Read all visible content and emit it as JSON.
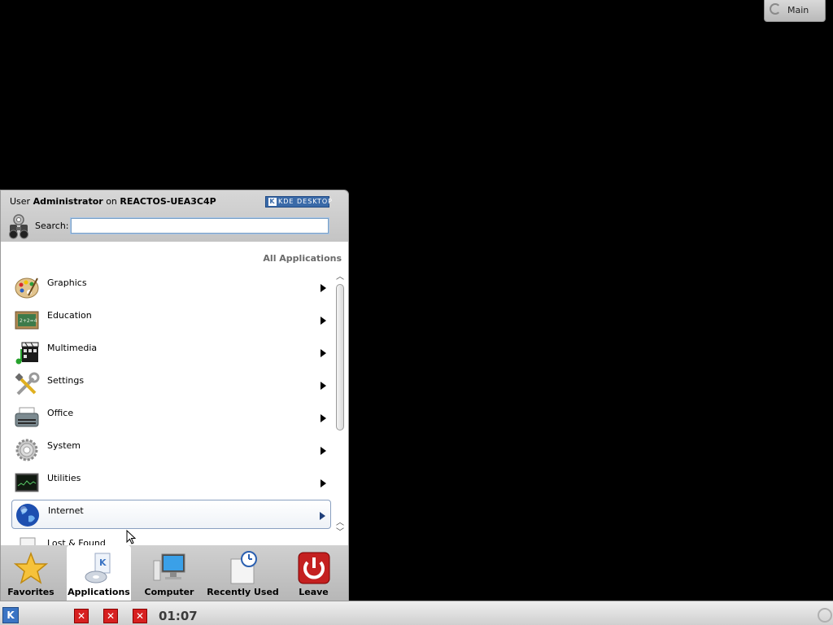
{
  "pager": {
    "label": "Main"
  },
  "launcher": {
    "header": {
      "user_prefix": "User",
      "user_name": "Administrator",
      "on_text": "on",
      "host": "REACTOS-UEA3C4P",
      "badge": "DESKTOP"
    },
    "search": {
      "label": "Search:",
      "value": "",
      "placeholder": ""
    },
    "section_title": "All Applications",
    "categories": [
      {
        "label": "Graphics",
        "icon": "palette-icon"
      },
      {
        "label": "Education",
        "icon": "chalkboard-icon"
      },
      {
        "label": "Multimedia",
        "icon": "film-music-icon"
      },
      {
        "label": "Settings",
        "icon": "tools-icon"
      },
      {
        "label": "Office",
        "icon": "typewriter-icon"
      },
      {
        "label": "System",
        "icon": "gear-icon"
      },
      {
        "label": "Utilities",
        "icon": "monitor-icon"
      },
      {
        "label": "Internet",
        "icon": "globe-icon"
      },
      {
        "label": "Lost & Found",
        "icon": "folder-icon"
      }
    ],
    "hovered_category": "Internet",
    "tabs": [
      {
        "label": "Favorites",
        "icon": "star-icon"
      },
      {
        "label": "Applications",
        "icon": "applications-icon"
      },
      {
        "label": "Computer",
        "icon": "computer-icon"
      },
      {
        "label": "Recently Used",
        "icon": "clock-document-icon"
      },
      {
        "label": "Leave",
        "icon": "power-icon"
      }
    ],
    "active_tab": "Applications"
  },
  "taskbar": {
    "clock": "01:07",
    "tasks": [
      "close-task-icon",
      "close-task-icon",
      "close-task-icon"
    ]
  }
}
